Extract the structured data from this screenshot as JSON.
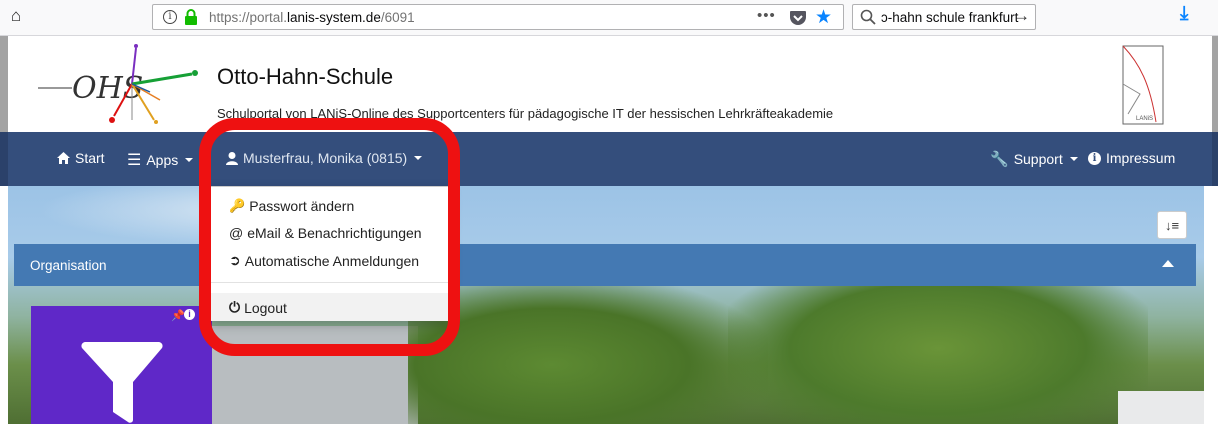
{
  "browser": {
    "url_prefix": "https://portal.",
    "url_host": "lanis-system.de",
    "url_path": "/6091",
    "search_value": "ɔ-hahn schule frankfurt",
    "icons": [
      "home-icon",
      "info-icon",
      "lock-icon",
      "page-actions-icon",
      "pocket-icon",
      "bookmark-star-icon",
      "search-icon",
      "arrow-right-icon",
      "download-icon"
    ]
  },
  "header": {
    "title": "Otto-Hahn-Schule",
    "subtitle": "Schulportal von LANiS-Online des Supportcenters für pädagogische IT der hessischen Lehrkräfteakademie",
    "logo_text": "OHS",
    "lanis_logo_text": "LANiS"
  },
  "nav": {
    "start": "Start",
    "apps": "Apps",
    "user": "Musterfrau, Monika (0815)",
    "support": "Support",
    "impressum": "Impressum"
  },
  "dropdown": {
    "password": "Passwort ändern",
    "email": "eMail & Benachrichtigungen",
    "auto_login": "Automatische Anmeldungen",
    "logout": "Logout"
  },
  "panel": {
    "title": "Organisation"
  },
  "colors": {
    "navbar": "#344e7c",
    "panel_header": "#4479b3",
    "tile": "#5f28c8",
    "highlight": "#ee1111",
    "browser_accent": "#0a84ff"
  }
}
